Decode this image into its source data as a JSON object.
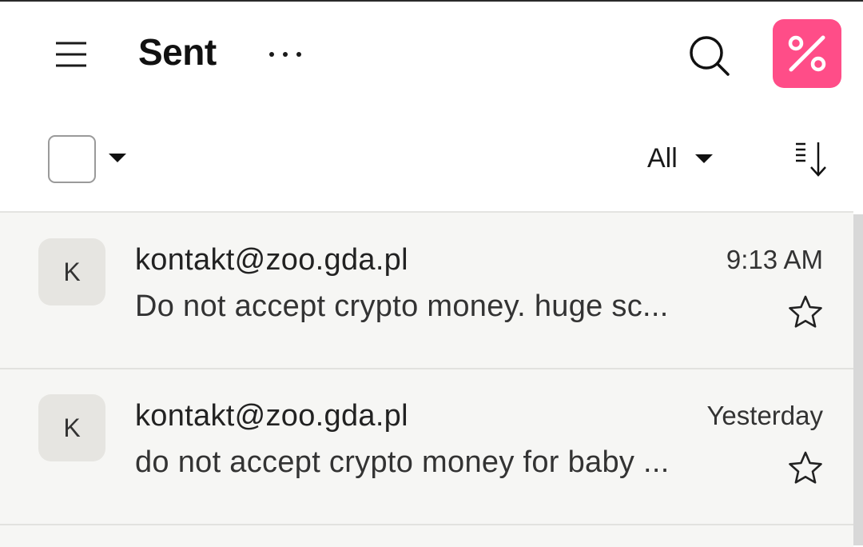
{
  "header": {
    "title": "Sent",
    "icons": {
      "menu": "hamburger-icon",
      "more": "more-horizontal-icon",
      "search": "search-icon",
      "promo": "percent-icon"
    },
    "promo_color": "#ff4d88"
  },
  "toolbar": {
    "filter_label": "All",
    "icons": {
      "select_caret": "caret-down-icon",
      "filter_caret": "caret-down-icon",
      "sort": "sort-icon"
    }
  },
  "messages": [
    {
      "avatar_letter": "K",
      "sender": "kontakt@zoo.gda.pl",
      "time": "9:13 AM",
      "snippet": "Do not accept crypto money. huge sc...",
      "starred": false
    },
    {
      "avatar_letter": "K",
      "sender": "kontakt@zoo.gda.pl",
      "time": "Yesterday",
      "snippet": "do not accept crypto money for baby ...",
      "starred": false
    }
  ]
}
